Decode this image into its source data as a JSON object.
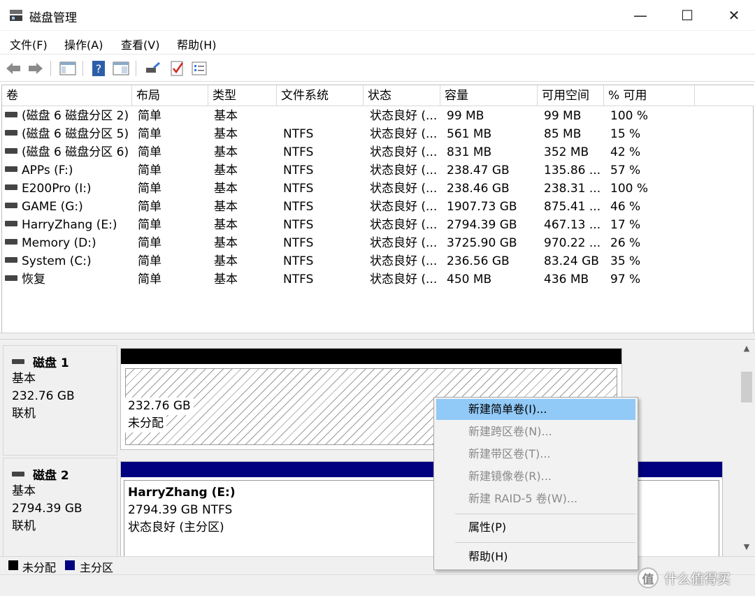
{
  "window": {
    "title": "磁盘管理",
    "minimize": "—",
    "maximize": "☐",
    "close": "✕"
  },
  "menu": [
    "文件(F)",
    "操作(A)",
    "查看(V)",
    "帮助(H)"
  ],
  "toolbar": [
    "back-icon",
    "forward-icon",
    "console-tree-icon",
    "help-icon",
    "view-icon",
    "connect-icon",
    "check-icon",
    "properties-icon"
  ],
  "columns": [
    "卷",
    "布局",
    "类型",
    "文件系统",
    "状态",
    "容量",
    "可用空间",
    "% 可用"
  ],
  "volumes": [
    {
      "name": "(磁盘 6 磁盘分区 2)",
      "layout": "简单",
      "type": "基本",
      "fs": "",
      "status": "状态良好 (...",
      "capacity": "99 MB",
      "free": "99 MB",
      "pct": "100 %"
    },
    {
      "name": "(磁盘 6 磁盘分区 5)",
      "layout": "简单",
      "type": "基本",
      "fs": "NTFS",
      "status": "状态良好 (...",
      "capacity": "561 MB",
      "free": "85 MB",
      "pct": "15 %"
    },
    {
      "name": "(磁盘 6 磁盘分区 6)",
      "layout": "简单",
      "type": "基本",
      "fs": "NTFS",
      "status": "状态良好 (...",
      "capacity": "831 MB",
      "free": "352 MB",
      "pct": "42 %"
    },
    {
      "name": "APPs (F:)",
      "layout": "简单",
      "type": "基本",
      "fs": "NTFS",
      "status": "状态良好 (...",
      "capacity": "238.47 GB",
      "free": "135.86 ...",
      "pct": "57 %"
    },
    {
      "name": "E200Pro (I:)",
      "layout": "简单",
      "type": "基本",
      "fs": "NTFS",
      "status": "状态良好 (...",
      "capacity": "238.46 GB",
      "free": "238.31 ...",
      "pct": "100 %"
    },
    {
      "name": "GAME (G:)",
      "layout": "简单",
      "type": "基本",
      "fs": "NTFS",
      "status": "状态良好 (...",
      "capacity": "1907.73 GB",
      "free": "875.41 ...",
      "pct": "46 %"
    },
    {
      "name": "HarryZhang (E:)",
      "layout": "简单",
      "type": "基本",
      "fs": "NTFS",
      "status": "状态良好 (...",
      "capacity": "2794.39 GB",
      "free": "467.13 ...",
      "pct": "17 %"
    },
    {
      "name": "Memory (D:)",
      "layout": "简单",
      "type": "基本",
      "fs": "NTFS",
      "status": "状态良好 (...",
      "capacity": "3725.90 GB",
      "free": "970.22 ...",
      "pct": "26 %"
    },
    {
      "name": "System (C:)",
      "layout": "简单",
      "type": "基本",
      "fs": "NTFS",
      "status": "状态良好 (...",
      "capacity": "236.56 GB",
      "free": "83.24 GB",
      "pct": "35 %"
    },
    {
      "name": "恢复",
      "layout": "简单",
      "type": "基本",
      "fs": "NTFS",
      "status": "状态良好 (...",
      "capacity": "450 MB",
      "free": "436 MB",
      "pct": "97 %"
    }
  ],
  "disks": [
    {
      "name": "磁盘 1",
      "type": "基本",
      "size": "232.76 GB",
      "state": "联机",
      "partition": {
        "line1": "232.76 GB",
        "line2": "未分配"
      }
    },
    {
      "name": "磁盘 2",
      "type": "基本",
      "size": "2794.39 GB",
      "state": "联机",
      "partition": {
        "line1": "HarryZhang  (E:)",
        "line2": "2794.39 GB NTFS",
        "line3": "状态良好 (主分区)"
      }
    }
  ],
  "legend": {
    "unallocated": "未分配",
    "primary": "主分区"
  },
  "colors": {
    "unallocated": "#000000",
    "primary": "#000080",
    "menu_highlight": "#91c9f7"
  },
  "context_menu": {
    "items": [
      {
        "label": "新建简单卷(I)...",
        "enabled": true,
        "selected": true
      },
      {
        "label": "新建跨区卷(N)...",
        "enabled": false
      },
      {
        "label": "新建带区卷(T)...",
        "enabled": false
      },
      {
        "label": "新建镜像卷(R)...",
        "enabled": false
      },
      {
        "label": "新建 RAID-5 卷(W)...",
        "enabled": false
      },
      {
        "label": "属性(P)",
        "enabled": true
      },
      {
        "label": "帮助(H)",
        "enabled": true
      }
    ]
  },
  "watermark": {
    "glyph": "值",
    "text": "什么值得买"
  }
}
